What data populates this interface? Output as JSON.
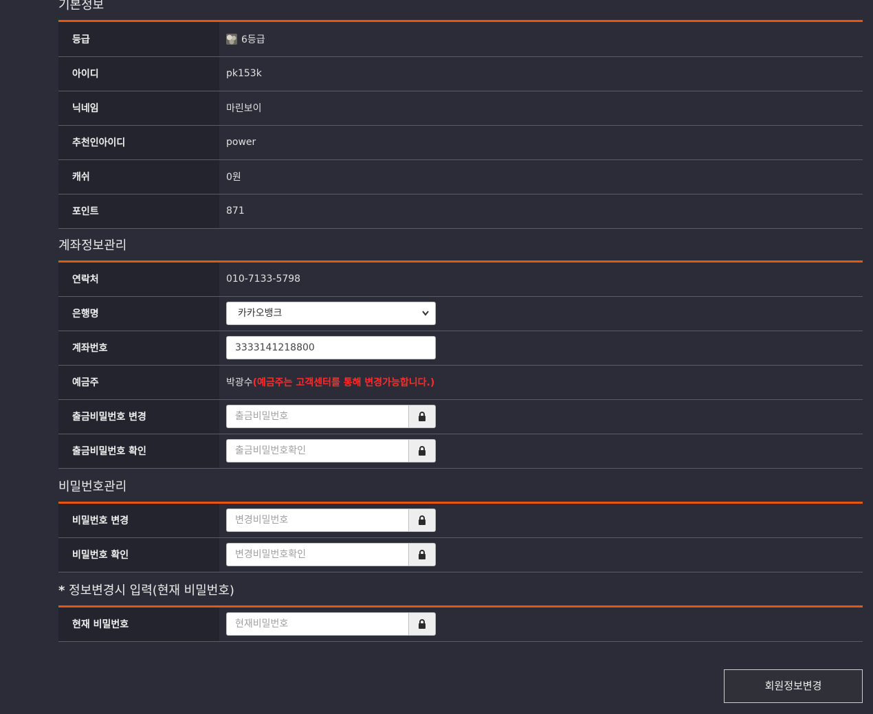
{
  "basic": {
    "title": "기본정보",
    "rows": [
      {
        "label": "등급",
        "value": "6등급",
        "icon": "grade-icon"
      },
      {
        "label": "아이디",
        "value": "pk153k"
      },
      {
        "label": "닉네임",
        "value": "마린보이"
      },
      {
        "label": "추천인아이디",
        "value": "power"
      },
      {
        "label": "캐쉬",
        "value": "0원"
      },
      {
        "label": "포인트",
        "value": "871"
      }
    ]
  },
  "account": {
    "title": "계좌정보관리",
    "phone_label": "연락처",
    "phone_value": "010-7133-5798",
    "bank_label": "은행명",
    "bank_selected": "카카오뱅크",
    "account_label": "계좌번호",
    "account_value": "3333141218800",
    "holder_label": "예금주",
    "holder_value": "박광수",
    "holder_notice": "(예금주는 고객센터를 통해 변경가능합니다.)",
    "withdraw_pw_label": "출금비밀번호 변경",
    "withdraw_pw_placeholder": "출금비밀번호",
    "withdraw_pw_confirm_label": "출금비밀번호 확인",
    "withdraw_pw_confirm_placeholder": "출금비밀번호확인"
  },
  "password": {
    "title": "비밀번호관리",
    "change_label": "비밀번호 변경",
    "change_placeholder": "변경비밀번호",
    "confirm_label": "비밀번호 확인",
    "confirm_placeholder": "변경비밀번호확인"
  },
  "current": {
    "title_star": "*",
    "title": "정보변경시 입력(현재 비밀번호)",
    "label": "현재 비밀번호",
    "placeholder": "현재비밀번호"
  },
  "submit_label": "회원정보변경",
  "colors": {
    "accent": "#e4570e",
    "warning": "#ff2b2b",
    "background": "#2b2c37"
  }
}
